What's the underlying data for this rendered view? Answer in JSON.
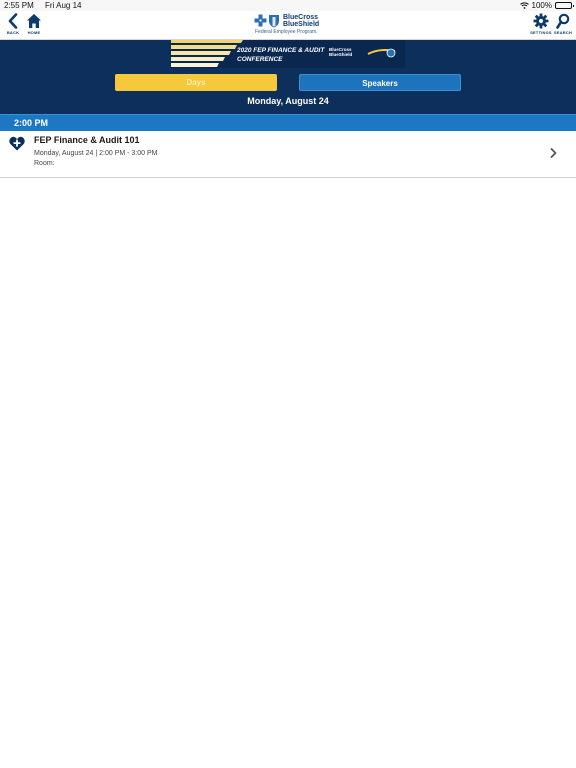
{
  "status_bar": {
    "time": "2:55 PM",
    "date": "Fri Aug 14",
    "battery": "100%",
    "battery_level": 1.0
  },
  "nav": {
    "back_label": "BACK",
    "home_label": "HOME",
    "settings_label": "SETTINGS",
    "search_label": "SEARCH",
    "brand_line1": "BlueCross",
    "brand_line2": "BlueShield",
    "brand_sub": "Federal Employee Program."
  },
  "banner": {
    "title_line1": "2020 FEP FINANCE & AUDIT",
    "title_line2": "CONFERENCE",
    "brand_line1": "BlueCross",
    "brand_line2": "BlueShield"
  },
  "tabs": {
    "days": "Days",
    "speakers": "Speakers"
  },
  "day_label": "Monday, August 24",
  "time_slot": "2:00 PM",
  "sessions": [
    {
      "title": "FEP Finance & Audit 101",
      "when": "Monday, August 24 | 2:00 PM - 3:00 PM",
      "room": "Room:"
    }
  ],
  "colors": {
    "navy": "#0d2f5c",
    "accent_blue": "#1d78c4",
    "gold": "#f6c83c",
    "brand_blue": "#0b3a6e"
  }
}
